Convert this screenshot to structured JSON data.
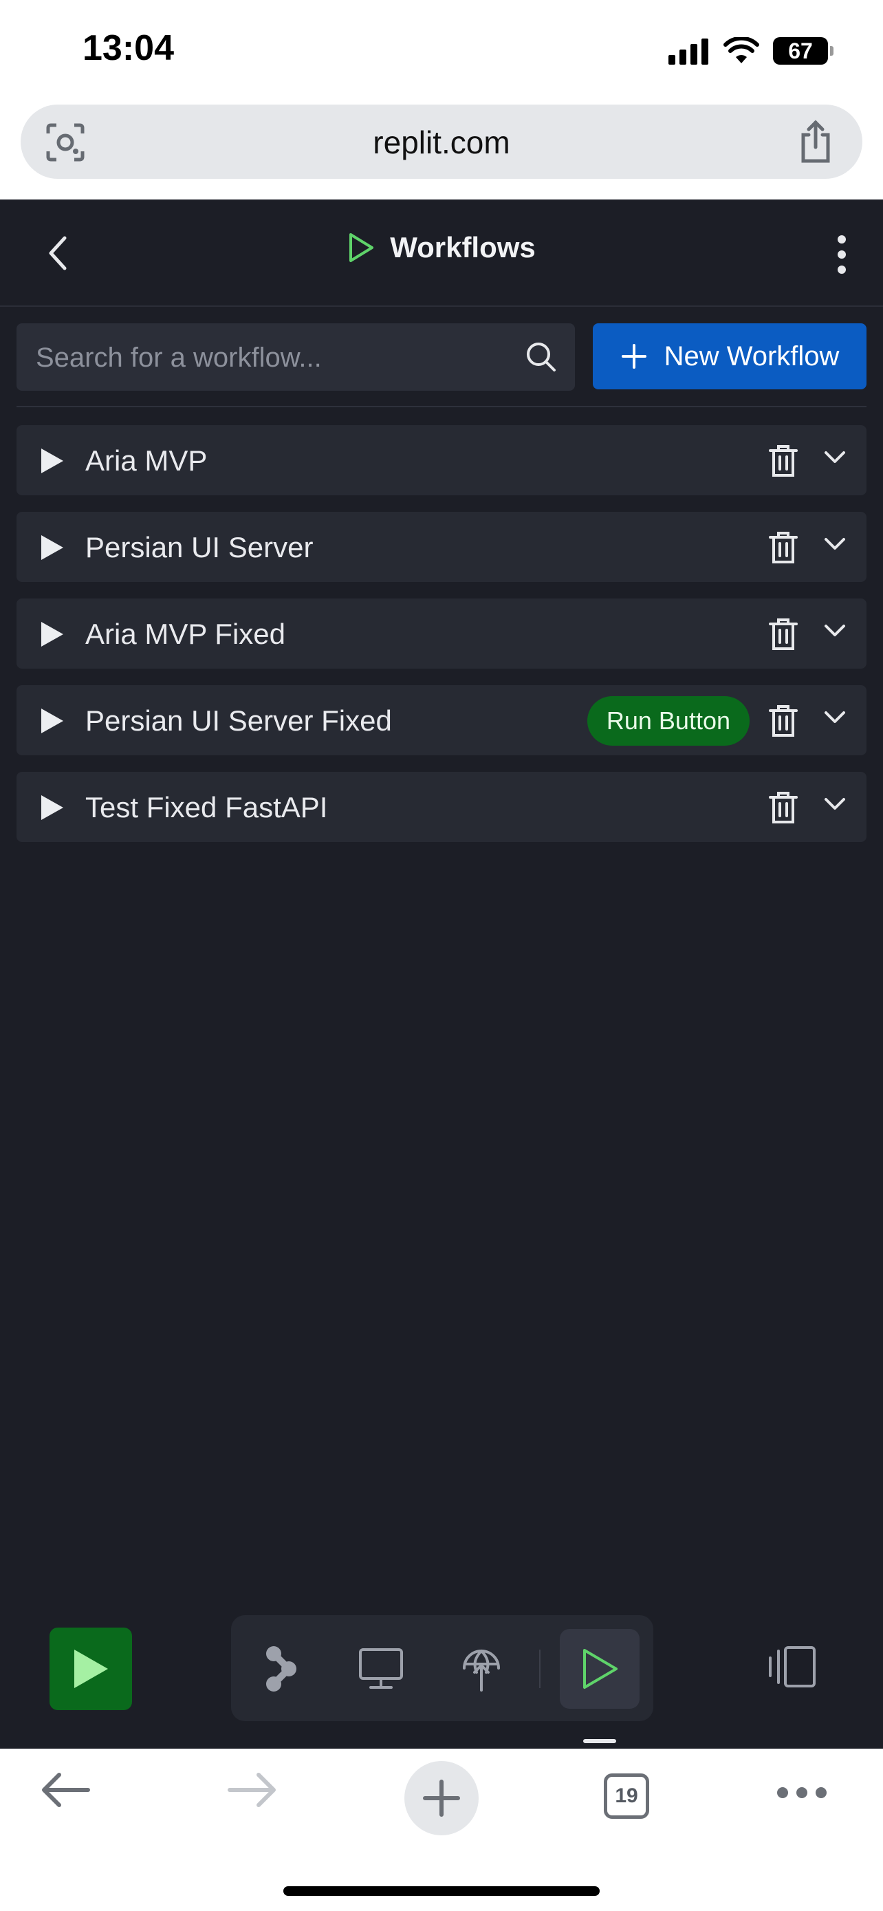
{
  "status_bar": {
    "time": "13:04",
    "battery": "67"
  },
  "browser": {
    "url": "replit.com",
    "tab_count": "19"
  },
  "header": {
    "title": "Workflows"
  },
  "search": {
    "placeholder": "Search for a workflow..."
  },
  "new_workflow": {
    "label": "New Workflow"
  },
  "workflows": [
    {
      "name": "Aria MVP"
    },
    {
      "name": "Persian UI Server"
    },
    {
      "name": "Aria MVP Fixed"
    },
    {
      "name": "Persian UI Server Fixed",
      "badge": "Run Button"
    },
    {
      "name": "Test Fixed FastAPI"
    }
  ],
  "colors": {
    "accent_green": "#0a6a1c",
    "play_green": "#5fd36a",
    "primary_blue": "#0b5cc2",
    "background": "#1c1e26"
  }
}
